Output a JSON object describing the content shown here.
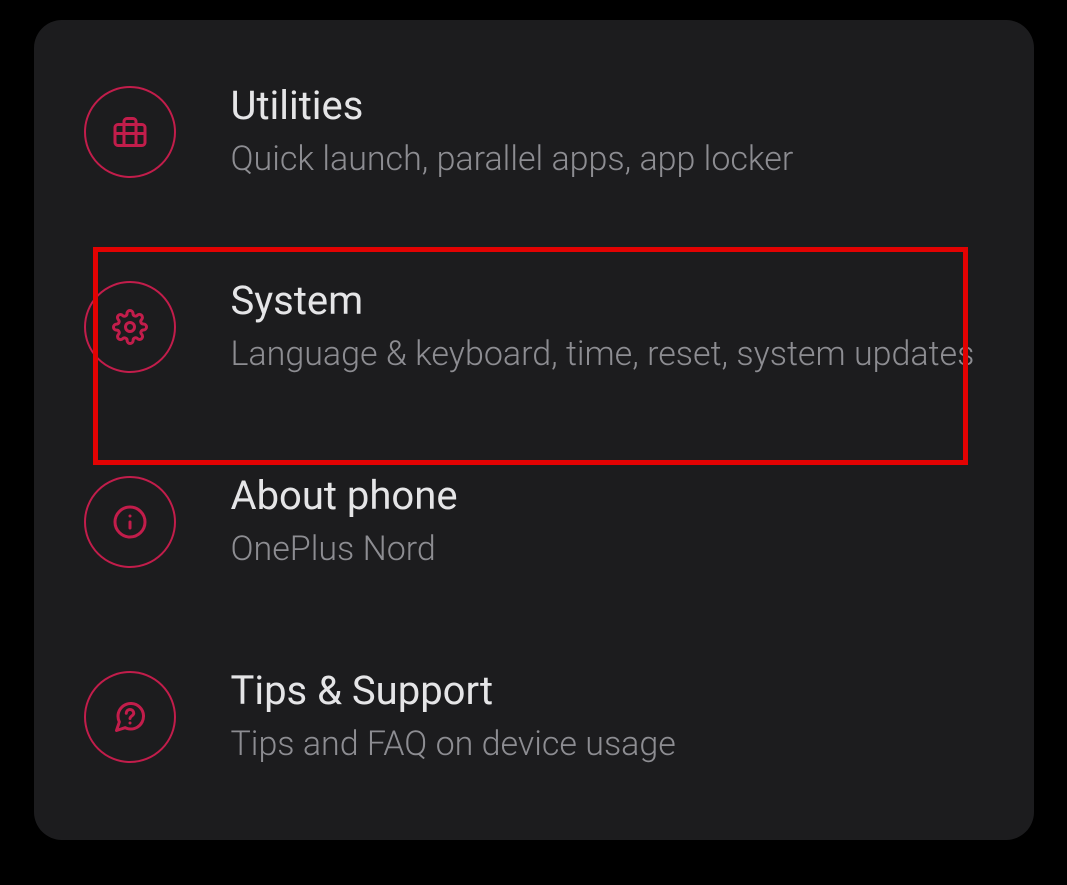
{
  "settings": {
    "items": [
      {
        "icon": "briefcase-icon",
        "title": "Utilities",
        "subtitle": "Quick launch, parallel apps, app locker"
      },
      {
        "icon": "gear-icon",
        "title": "System",
        "subtitle": "Language & keyboard, time, reset, system updates"
      },
      {
        "icon": "info-icon",
        "title": "About phone",
        "subtitle": "OnePlus Nord"
      },
      {
        "icon": "question-icon",
        "title": "Tips & Support",
        "subtitle": "Tips and FAQ on device usage"
      }
    ]
  },
  "colors": {
    "accent": "#c21d4b",
    "highlight": "#e20202",
    "background": "#1c1c1e",
    "text_primary": "#e5e5e7",
    "text_secondary": "#8d8d92"
  }
}
